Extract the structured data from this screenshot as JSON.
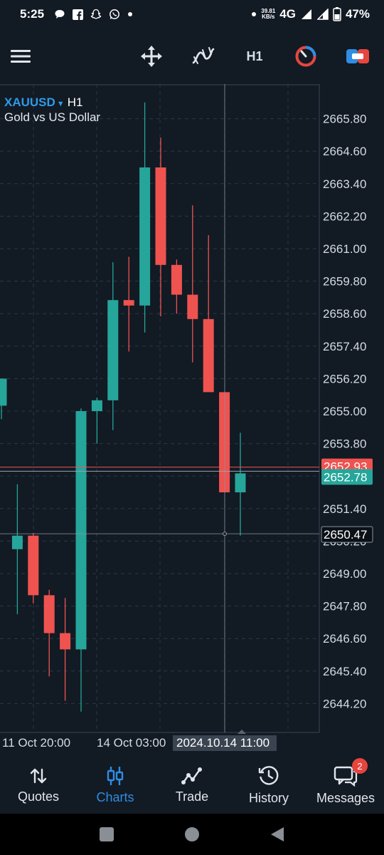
{
  "status_bar": {
    "time": "5:25",
    "left_icons": [
      "chat-bubble-icon",
      "facebook-icon",
      "snapchat-icon",
      "whatsapp-icon",
      "dot-icon"
    ],
    "net_speed_value": "39.81",
    "net_speed_unit": "KB/s",
    "network": "4G",
    "battery": "47%"
  },
  "toolbar": {
    "menu_icon": "hamburger-menu-icon",
    "crosshair_icon": "crosshair-move-icon",
    "indicators_icon": "indicators-icon",
    "timeframe": "H1",
    "one_click_icon": "one-click-trading-icon",
    "trade_icon": "new-order-icon"
  },
  "chart": {
    "symbol": "XAUUSD",
    "timeframe": "H1",
    "description": "Gold vs US Dollar",
    "colors": {
      "bull": "#26a69a",
      "bear": "#ef5350",
      "grid": "#2b3846",
      "background": "#121a24"
    },
    "crosshair_price": "2650.47",
    "current_bid": "2652.78",
    "ask_label_partial": "2652.93",
    "time_labels": [
      "11 Oct 20:00",
      "14 Oct 03:00"
    ],
    "crosshair_time": "2024.10.14 11:00"
  },
  "chart_data": {
    "type": "candlestick",
    "ylim": [
      2643.0,
      2667.0
    ],
    "y_ticks": [
      "2665.80",
      "2664.60",
      "2663.40",
      "2662.20",
      "2661.00",
      "2659.80",
      "2658.60",
      "2657.40",
      "2656.20",
      "2655.00",
      "2653.80",
      "2652.60",
      "2651.40",
      "2650.20",
      "2649.00",
      "2647.80",
      "2646.60",
      "2645.40",
      "2644.20"
    ],
    "candles": [
      {
        "o": 2655.2,
        "h": 2656.2,
        "l": 2654.7,
        "c": 2656.2
      },
      {
        "o": 2649.9,
        "h": 2652.3,
        "l": 2647.5,
        "c": 2650.4
      },
      {
        "o": 2650.4,
        "h": 2650.5,
        "l": 2647.9,
        "c": 2648.2
      },
      {
        "o": 2648.2,
        "h": 2648.4,
        "l": 2645.2,
        "c": 2646.8
      },
      {
        "o": 2646.8,
        "h": 2648.1,
        "l": 2644.3,
        "c": 2646.2
      },
      {
        "o": 2646.2,
        "h": 2655.1,
        "l": 2643.9,
        "c": 2655.0
      },
      {
        "o": 2655.0,
        "h": 2655.5,
        "l": 2653.8,
        "c": 2655.4
      },
      {
        "o": 2655.4,
        "h": 2660.5,
        "l": 2654.3,
        "c": 2659.1
      },
      {
        "o": 2659.1,
        "h": 2660.7,
        "l": 2657.2,
        "c": 2658.9
      },
      {
        "o": 2658.9,
        "h": 2666.4,
        "l": 2657.9,
        "c": 2664.0
      },
      {
        "o": 2664.0,
        "h": 2665.1,
        "l": 2658.5,
        "c": 2660.4
      },
      {
        "o": 2660.4,
        "h": 2660.6,
        "l": 2658.6,
        "c": 2659.3
      },
      {
        "o": 2659.3,
        "h": 2662.6,
        "l": 2656.8,
        "c": 2658.4
      },
      {
        "o": 2658.4,
        "h": 2661.5,
        "l": 2656.7,
        "c": 2655.7
      },
      {
        "o": 2655.7,
        "h": 2655.7,
        "l": 2652.0,
        "c": 2652.0
      },
      {
        "o": 2652.0,
        "h": 2654.2,
        "l": 2650.4,
        "c": 2652.7
      }
    ]
  },
  "bottom_nav": [
    {
      "label": "Quotes",
      "icon": "quotes-arrows-icon",
      "active": false
    },
    {
      "label": "Charts",
      "icon": "charts-candles-icon",
      "active": true
    },
    {
      "label": "Trade",
      "icon": "trade-line-icon",
      "active": false
    },
    {
      "label": "History",
      "icon": "history-clock-icon",
      "active": false
    },
    {
      "label": "Messages",
      "icon": "messages-chat-icon",
      "active": false,
      "badge": "2"
    }
  ],
  "system_nav": [
    "recents-square-icon",
    "home-circle-icon",
    "back-triangle-icon"
  ]
}
